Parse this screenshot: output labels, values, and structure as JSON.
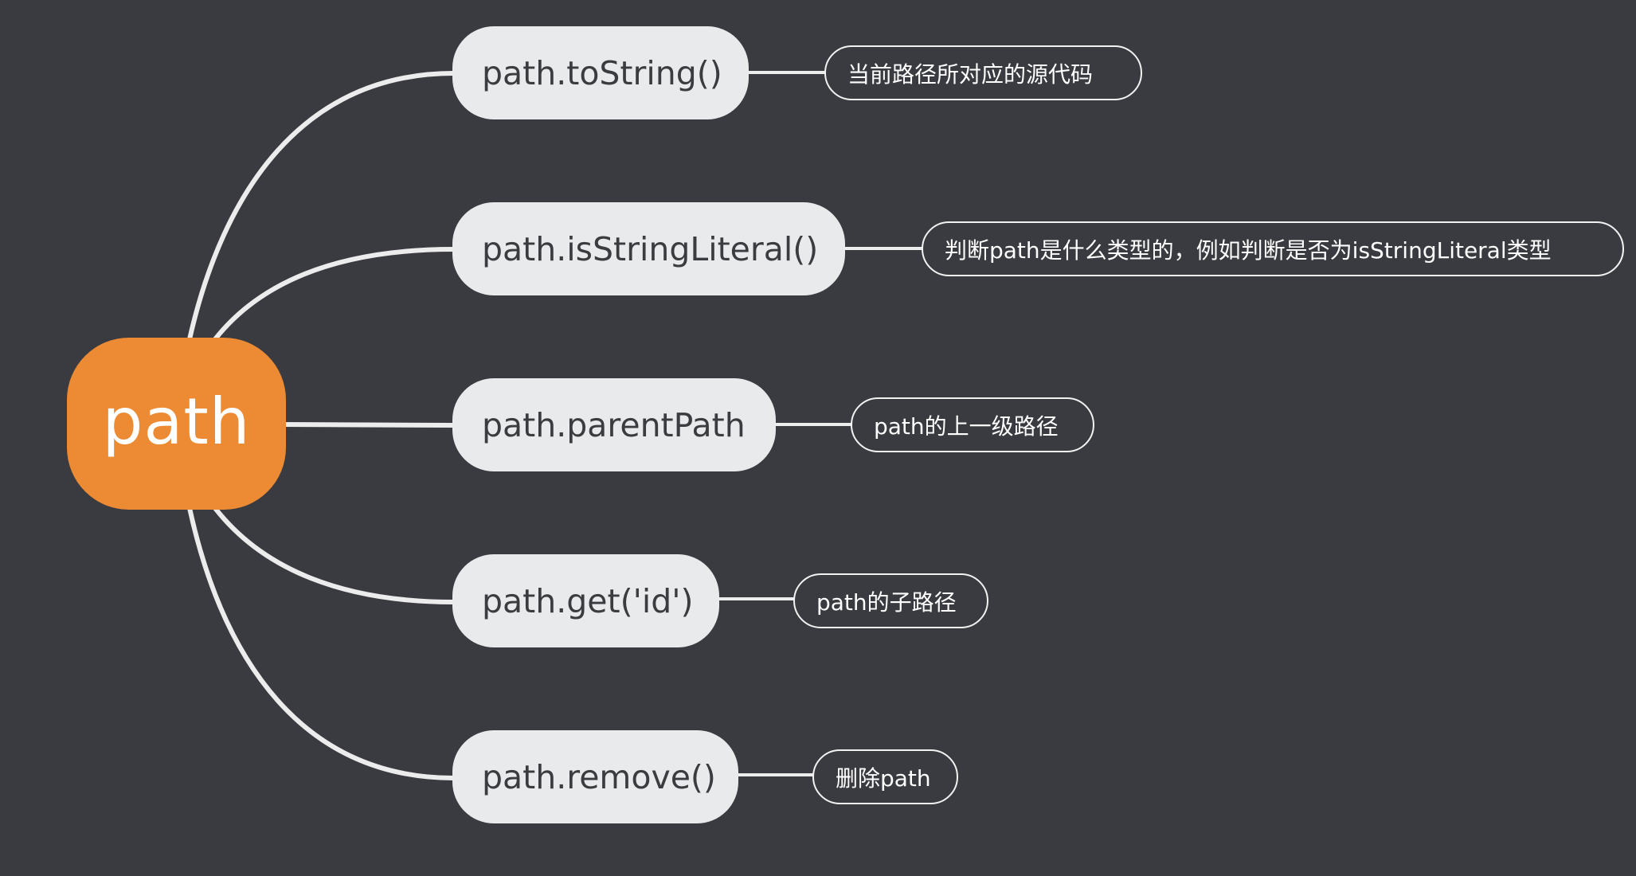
{
  "root": {
    "label": "path"
  },
  "branches": [
    {
      "label": "path.toString()",
      "note": "当前路径所对应的源代码"
    },
    {
      "label": "path.isStringLiteral()",
      "note": "判断path是什么类型的，例如判断是否为isStringLiteral类型"
    },
    {
      "label": "path.parentPath",
      "note": "path的上一级路径"
    },
    {
      "label": "path.get('id')",
      "note": "path的子路径"
    },
    {
      "label": "path.remove()",
      "note": "删除path"
    }
  ],
  "colors": {
    "background": "#3a3b40",
    "root_fill": "#ed8a34",
    "branch_fill": "#e9eaec",
    "connector": "#eeeeee"
  }
}
